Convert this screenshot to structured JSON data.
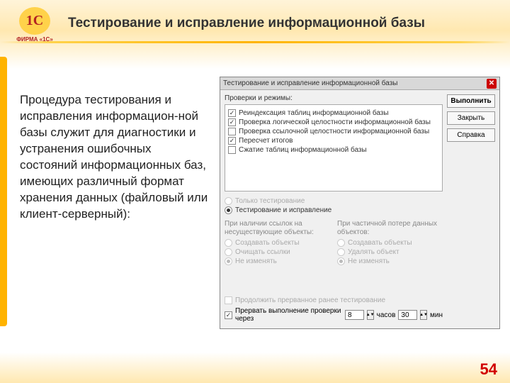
{
  "logo": {
    "badge": "1C",
    "subtitle": "ФИРМА «1С»"
  },
  "title": "Тестирование и исправление информационной базы",
  "description": "Процедура тестирования и исправления информацион-ной базы служит для диагностики и устранения ошибочных состояний информационных баз, имеющих различный формат хранения данных (файловый или клиент-серверный):",
  "dialog": {
    "title": "Тестирование и исправление информационной базы",
    "buttons": {
      "execute": "Выполнить",
      "close": "Закрыть",
      "help": "Справка"
    },
    "checks_label": "Проверки и режимы:",
    "checks": [
      {
        "label": "Реиндексация таблиц информационной базы",
        "checked": true
      },
      {
        "label": "Проверка логической целостности информационной базы",
        "checked": true
      },
      {
        "label": "Проверка ссылочной целостности информационной базы",
        "checked": false
      },
      {
        "label": "Пересчет итогов",
        "checked": true
      },
      {
        "label": "Сжатие таблиц информационной базы",
        "checked": false
      }
    ],
    "mode": {
      "opt1": "Только тестирование",
      "opt2": "Тестирование и исправление",
      "selected": 1
    },
    "left_col": {
      "label": "При наличии ссылок на несуществующие объекты:",
      "opts": [
        "Создавать объекты",
        "Очищать ссылки",
        "Не изменять"
      ],
      "selected": 2
    },
    "right_col": {
      "label": "При частичной потере данных объектов:",
      "opts": [
        "Создавать объекты",
        "Удалять объект",
        "Не изменять"
      ],
      "selected": 2
    },
    "continue_prev": "Продолжить прерванное ранее тестирование",
    "abort_row": {
      "label": "Прервать выполнение проверки через",
      "hours_val": "8",
      "hours_unit": "часов",
      "mins_val": "30",
      "mins_unit": "мин",
      "checked": true
    }
  },
  "page": "54"
}
